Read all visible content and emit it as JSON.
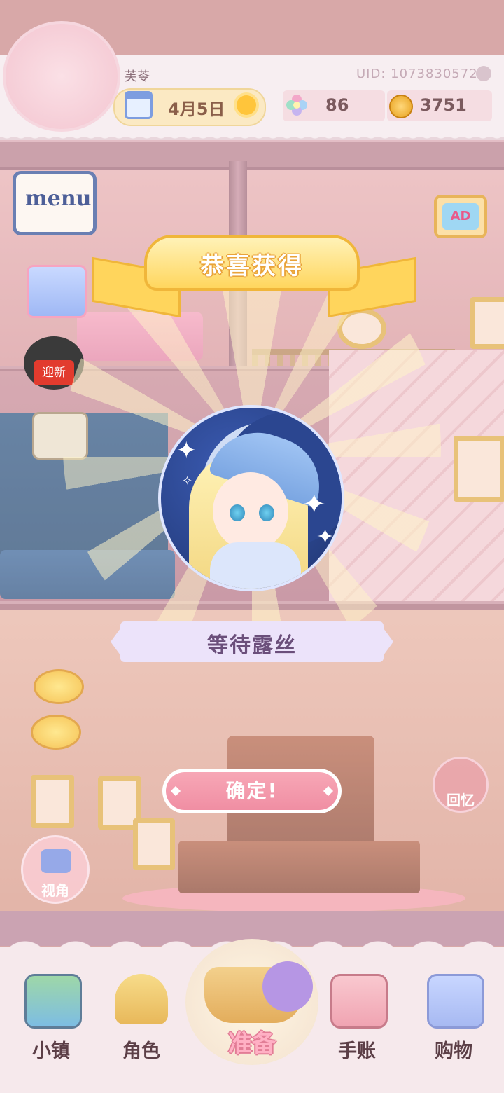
{
  "header": {
    "player_name": "芙苓",
    "uid": "UID: 1073830572",
    "date": "4月5日",
    "gems": "86",
    "coins": "3751"
  },
  "side_buttons": {
    "menu_label": "menu",
    "newyear_label": "迎新",
    "ad_label": "AD",
    "memory_label": "回忆",
    "view_label": "视角"
  },
  "reward_popup": {
    "banner_title": "恭喜获得",
    "item_name": "等待露丝",
    "confirm_label": "确定!"
  },
  "bottom_nav": {
    "items": [
      {
        "label": "小镇",
        "icon": "map-icon"
      },
      {
        "label": "角色",
        "icon": "character-icon"
      },
      {
        "label": "准备",
        "icon": "basket-icon"
      },
      {
        "label": "手账",
        "icon": "journal-icon"
      },
      {
        "label": "购物",
        "icon": "shopping-bag-icon"
      }
    ]
  },
  "colors": {
    "ribbon": "#ffd65e",
    "confirm": "#f08ea3",
    "name_plate": "#ece3fa",
    "portrait_bg": "#1f3570"
  }
}
